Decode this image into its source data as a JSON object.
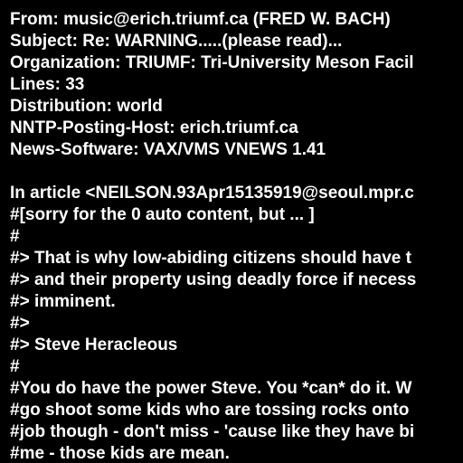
{
  "colors": {
    "background": "#000000",
    "text": "#ffffff"
  },
  "article": {
    "lines": [
      "From: music@erich.triumf.ca (FRED W. BACH)",
      "Subject: Re: WARNING.....(please read)...",
      "Organization: TRIUMF: Tri-University Meson Facil",
      "Lines: 33",
      "Distribution: world",
      "NNTP-Posting-Host: erich.triumf.ca",
      "News-Software: VAX/VMS VNEWS 1.41",
      "",
      "In article <NEILSON.93Apr15135919@seoul.mpr.c",
      "#[sorry for the 0 auto content, but ... ]",
      "#",
      "#> That is why low-abiding citizens should have t",
      "#> and their property using deadly force if necess",
      "#> imminent.",
      "#>",
      "#> Steve Heracleous",
      "#",
      "#You do have the power Steve. You *can* do it. W",
      "#go shoot some kids who are tossing rocks onto",
      "#job though - don't miss - 'cause like they have bi",
      "#me - those kids are mean."
    ]
  }
}
